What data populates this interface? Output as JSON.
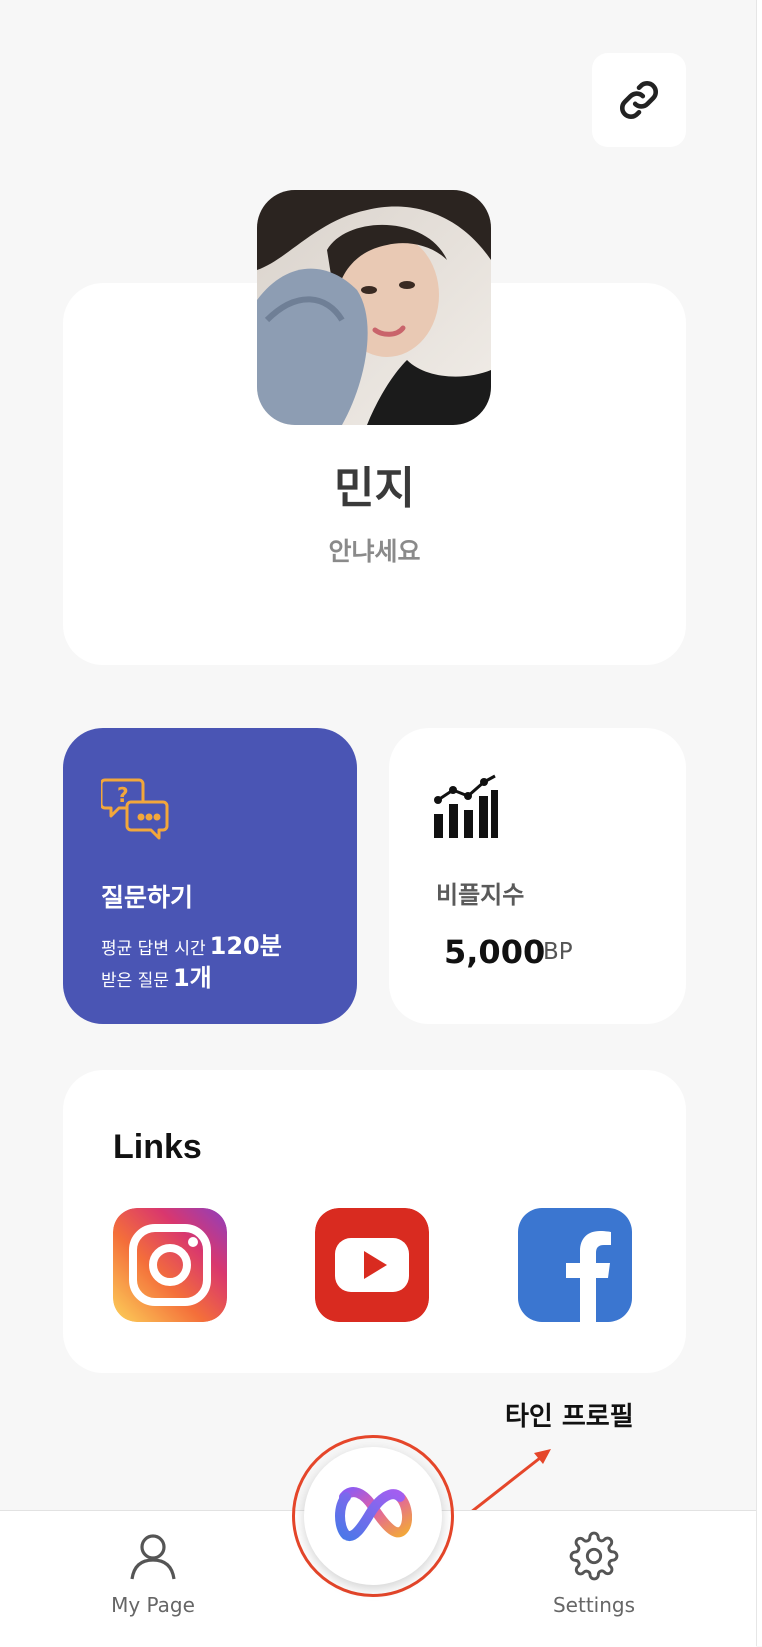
{
  "profile": {
    "name": "민지",
    "bio": "안냐세요"
  },
  "ask_card": {
    "title": "질문하기",
    "avg_label": "평균 답변 시간",
    "avg_value": "120분",
    "received_label": "받은 질문",
    "received_value": "1개",
    "accent_color": "#4a55b4"
  },
  "bp_card": {
    "title": "비플지수",
    "value": "5,000",
    "unit": "BP"
  },
  "links": {
    "title": "Links",
    "items": [
      {
        "name": "Instagram",
        "icon": "instagram-icon"
      },
      {
        "name": "YouTube",
        "icon": "youtube-icon"
      },
      {
        "name": "Facebook",
        "icon": "facebook-icon"
      }
    ]
  },
  "annotation": {
    "label": "타인 프로필",
    "color": "#e5462a"
  },
  "bottom_nav": {
    "left_label": "My Page",
    "right_label": "Settings"
  }
}
